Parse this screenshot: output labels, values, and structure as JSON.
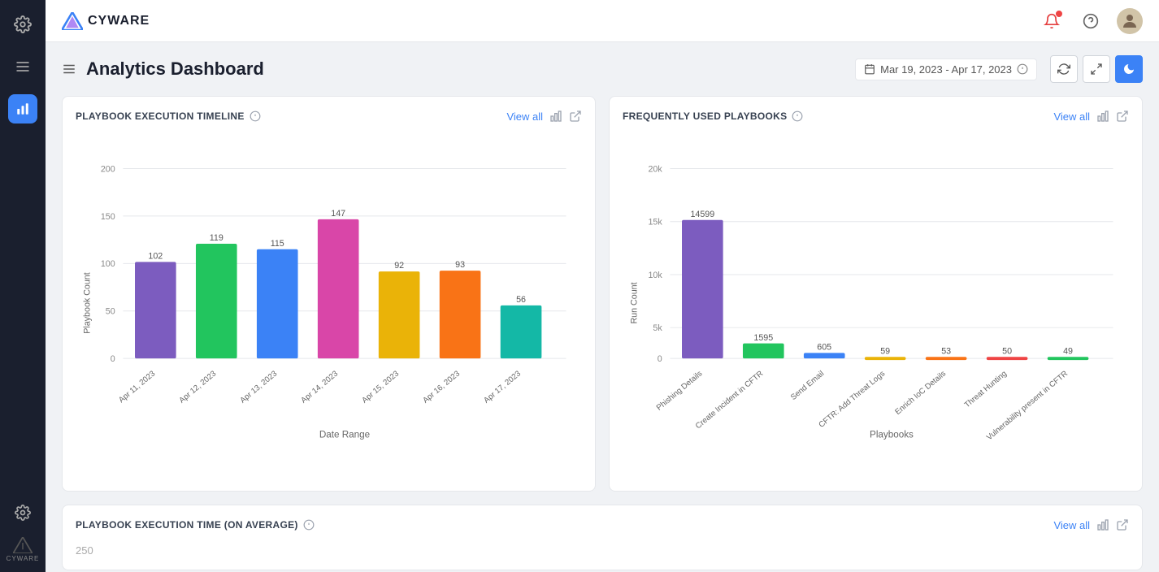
{
  "topbar": {
    "logo_text": "CYWARE"
  },
  "page": {
    "title": "Analytics Dashboard",
    "date_range": "Mar 19, 2023 - Apr 17, 2023"
  },
  "chart1": {
    "title": "PLAYBOOK EXECUTION TIMELINE",
    "view_all": "View all",
    "x_label": "Date Range",
    "y_label": "Playbook Count",
    "bars": [
      {
        "label": "Apr 11, 2023",
        "value": 102,
        "color": "#7c5cbf"
      },
      {
        "label": "Apr 12, 2023",
        "value": 119,
        "color": "#22c55e"
      },
      {
        "label": "Apr 13, 2023",
        "value": 115,
        "color": "#3b82f6"
      },
      {
        "label": "Apr 14, 2023",
        "value": 147,
        "color": "#d946a8"
      },
      {
        "label": "Apr 15, 2023",
        "value": 92,
        "color": "#eab308"
      },
      {
        "label": "Apr 16, 2023",
        "value": 93,
        "color": "#f97316"
      },
      {
        "label": "Apr 17, 2023",
        "value": 56,
        "color": "#14b8a6"
      }
    ],
    "y_ticks": [
      0,
      50,
      100,
      150,
      200
    ]
  },
  "chart2": {
    "title": "FREQUENTLY USED PLAYBOOKS",
    "view_all": "View all",
    "x_label": "Playbooks",
    "y_label": "Run Count",
    "bars": [
      {
        "label": "Phishing Details",
        "value": 14599,
        "color": "#7c5cbf"
      },
      {
        "label": "Create Incident in CFTR",
        "value": 1595,
        "color": "#22c55e"
      },
      {
        "label": "Send Email",
        "value": 605,
        "color": "#3b82f6"
      },
      {
        "label": "CFTR: Add Threat Logs",
        "value": 59,
        "color": "#eab308"
      },
      {
        "label": "Enrich IoC Details",
        "value": 53,
        "color": "#f97316"
      },
      {
        "label": "Threat Hunting",
        "value": 50,
        "color": "#ef4444"
      },
      {
        "label": "Vulnerability present in CFTR",
        "value": 49,
        "color": "#22c55e"
      }
    ],
    "y_ticks": [
      0,
      "5k",
      "10k",
      "15k",
      "20k"
    ]
  },
  "chart3": {
    "title": "PLAYBOOK EXECUTION TIME (ON AVERAGE)",
    "view_all": "View all"
  },
  "sidebar": {
    "logo_text": "CYWARE"
  }
}
